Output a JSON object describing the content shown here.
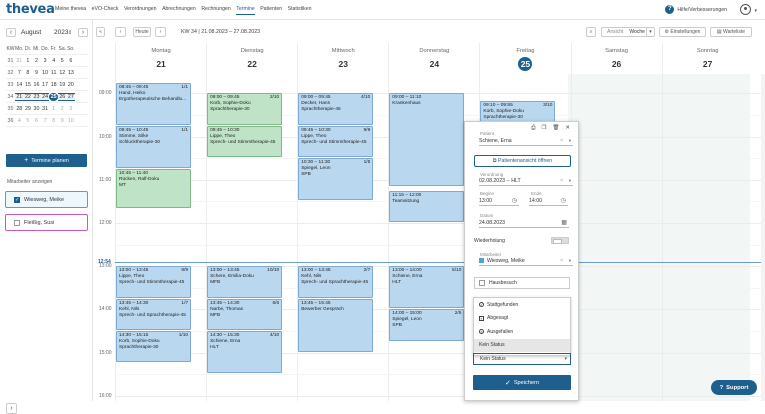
{
  "app": {
    "logo": "thevea"
  },
  "nav": [
    "Meine thevea",
    "eVO-Check",
    "Verordnungen",
    "Abrechnungen",
    "Rechnungen",
    "Termine",
    "Patienten",
    "Statistiken"
  ],
  "nav_active": "Termine",
  "help": "Hilfe/Verbesserungen",
  "minical": {
    "month": "August",
    "year": "2023",
    "headers": [
      "KW",
      "Mo.",
      "Di.",
      "Mi.",
      "Do.",
      "Fr.",
      "Sa.",
      "So."
    ],
    "weeks": [
      {
        "kw": "31",
        "days": [
          "31",
          "1",
          "2",
          "3",
          "4",
          "5",
          "6"
        ]
      },
      {
        "kw": "32",
        "days": [
          "7",
          "8",
          "9",
          "10",
          "11",
          "12",
          "13"
        ]
      },
      {
        "kw": "33",
        "days": [
          "14",
          "15",
          "16",
          "17",
          "18",
          "19",
          "20"
        ]
      },
      {
        "kw": "34",
        "days": [
          "21",
          "22",
          "23",
          "24",
          "25",
          "26",
          "27"
        ]
      },
      {
        "kw": "35",
        "days": [
          "28",
          "29",
          "30",
          "31",
          "1",
          "2",
          "3"
        ]
      },
      {
        "kw": "36",
        "days": [
          "4",
          "5",
          "6",
          "7",
          "8",
          "9",
          "10"
        ]
      }
    ]
  },
  "plan_button": "Termine planen",
  "staff_label": "Mitarbeiter anzeigen",
  "staff": [
    {
      "name": "Wiesweg, Meike",
      "checked": true,
      "color": "#4aa3d8"
    },
    {
      "name": "Fleißig, Susi",
      "checked": false,
      "color": "#c45ac8"
    }
  ],
  "toolbar": {
    "today": "Heute",
    "kw": "KW 34 | 21.08.2023 – 27.08.2023",
    "view_label": "Ansicht",
    "view_value": "Woche",
    "settings": "Einstellungen",
    "waitlist": "Warteliste"
  },
  "days": [
    {
      "name": "Montag",
      "date": "21"
    },
    {
      "name": "Dienstag",
      "date": "22"
    },
    {
      "name": "Mittwoch",
      "date": "23"
    },
    {
      "name": "Donnerstag",
      "date": "24"
    },
    {
      "name": "Freitag",
      "date": "25",
      "today": true
    },
    {
      "name": "Samstag",
      "date": "26"
    },
    {
      "name": "Sonntag",
      "date": "27"
    }
  ],
  "hours": [
    "09:00",
    "10:00",
    "11:00",
    "12:00",
    "13:00",
    "14:00",
    "15:00",
    "16:00"
  ],
  "now_time": "12:54",
  "events": [
    {
      "day": 0,
      "start": "08:45",
      "end": "09:45",
      "time": "08:45 – 09:45",
      "count": "1/1",
      "name": "Hand, Heiko",
      "type": "Ergotherapeutische Behandlu...",
      "color": "blue"
    },
    {
      "day": 0,
      "start": "09:45",
      "end": "10:45",
      "time": "09:45 – 10:45",
      "count": "1/1",
      "name": "Stimme, Silke",
      "type": "Schlucktherapie-30",
      "color": "blue"
    },
    {
      "day": 0,
      "start": "10:45",
      "end": "11:40",
      "time": "10:45 – 11:40",
      "count": "",
      "name": "Rücken, Ralf-Doku",
      "type": "MT",
      "color": "green"
    },
    {
      "day": 0,
      "start": "13:00",
      "end": "13:45",
      "time": "13:00 – 13:45",
      "count": "8/9",
      "name": "Lippe, Theo",
      "type": "Sprech- und Stimmtherapie-45",
      "color": "blue"
    },
    {
      "day": 0,
      "start": "13:45",
      "end": "14:30",
      "time": "13:45 – 14:30",
      "count": "1/7",
      "name": "Kehl, Nils",
      "type": "Sprech- und Sprachtherapie-45",
      "color": "blue"
    },
    {
      "day": 0,
      "start": "14:30",
      "end": "15:15",
      "time": "14:30 – 15:15",
      "count": "1/10",
      "name": "Korb, Sophie-Doku",
      "type": "Sprachtherapie-30",
      "color": "blue"
    },
    {
      "day": 1,
      "start": "09:00",
      "end": "09:45",
      "time": "09:00 – 09:45",
      "count": "2/10",
      "name": "Korb, Sophie-Doku",
      "type": "Sprachtherapie-30",
      "color": "green"
    },
    {
      "day": 1,
      "start": "09:45",
      "end": "10:30",
      "time": "09:45 – 10:30",
      "count": "",
      "name": "Lippe, Theo",
      "type": "Sprech- und Stimmtherapie-45",
      "color": "green"
    },
    {
      "day": 1,
      "start": "13:00",
      "end": "13:45",
      "time": "13:00 – 13:45",
      "count": "10/10",
      "name": "Schere, Emilia-Doku",
      "type": "MFB",
      "color": "blue"
    },
    {
      "day": 1,
      "start": "13:45",
      "end": "14:30",
      "time": "13:45 – 14:30",
      "count": "6/6",
      "name": "Narbe, Thomas",
      "type": "MFB",
      "color": "blue"
    },
    {
      "day": 1,
      "start": "14:30",
      "end": "15:30",
      "time": "14:30 – 15:30",
      "count": "4/10",
      "name": "Schiene, Erna",
      "type": "HLT",
      "color": "blue"
    },
    {
      "day": 2,
      "start": "09:00",
      "end": "09:45",
      "time": "09:00 – 09:45",
      "count": "4/10",
      "name": "Decker, Hans",
      "type": "Sprachtherapie-45",
      "color": "blue"
    },
    {
      "day": 2,
      "start": "09:45",
      "end": "10:30",
      "time": "09:45 – 10:30",
      "count": "9/9",
      "name": "Lippe, Theo",
      "type": "Sprech- und Stimmtherapie-45",
      "color": "blue"
    },
    {
      "day": 2,
      "start": "10:30",
      "end": "11:30",
      "time": "10:30 – 11:30",
      "count": "1/5",
      "name": "Spiegel, Leon",
      "type": "SPB",
      "color": "blue"
    },
    {
      "day": 2,
      "start": "13:00",
      "end": "13:45",
      "time": "13:00 – 13:45",
      "count": "2/7",
      "name": "Kehl, Nils",
      "type": "Sprech- und Sprachtherapie-45",
      "color": "blue"
    },
    {
      "day": 2,
      "start": "13:45",
      "end": "15:00",
      "time": "13:45 – 15:45",
      "count": "",
      "name": "Bewerber Gespräch",
      "type": "",
      "color": "blue"
    },
    {
      "day": 3,
      "start": "09:00",
      "end": "11:10",
      "time": "09:00 – 11:10",
      "count": "",
      "name": "Krankenhaus",
      "type": "",
      "color": "blue"
    },
    {
      "day": 3,
      "start": "11:15",
      "end": "12:00",
      "time": "11:15 – 12:00",
      "count": "",
      "name": "Teamsitzung",
      "type": "",
      "color": "blue"
    },
    {
      "day": 3,
      "start": "13:00",
      "end": "14:00",
      "time": "13:00 – 14:00",
      "count": "5/10",
      "name": "Schiene, Erna",
      "type": "HLT",
      "color": "blue"
    },
    {
      "day": 3,
      "start": "14:00",
      "end": "14:45",
      "time": "14:00 – 15:00",
      "count": "2/5",
      "name": "Spiegel, Leon",
      "type": "SPB",
      "color": "blue"
    },
    {
      "day": 4,
      "start": "09:10",
      "end": "09:55",
      "time": "09:10 – 09:55",
      "count": "3/10",
      "name": "Korb, Sophie-Doku",
      "type": "Sprachtherapie-30",
      "color": "blue"
    }
  ],
  "panel": {
    "patient_label": "Patient",
    "patient": "Schiene, Erna",
    "open_btn": "Patientenansicht öffnen",
    "vo_label": "Verordnung",
    "vo": "02.08.2023 -- HLT",
    "start_label": "Beginn",
    "start": "13:00",
    "end_label": "Ende",
    "end": "14:00",
    "date_label": "Datum",
    "date": "24.08.2023",
    "repeat_label": "Wiederholung",
    "staff_label": "Mitarbeiter",
    "staff": "Wiesweg, Meike",
    "home_visit": "Hausbesuch",
    "status_options": [
      "Stattgefunden",
      "Abgesagt",
      "Ausgefallen",
      "Kein Status"
    ],
    "status_value": "Kein Status",
    "save": "Speichern"
  },
  "support": "Support"
}
